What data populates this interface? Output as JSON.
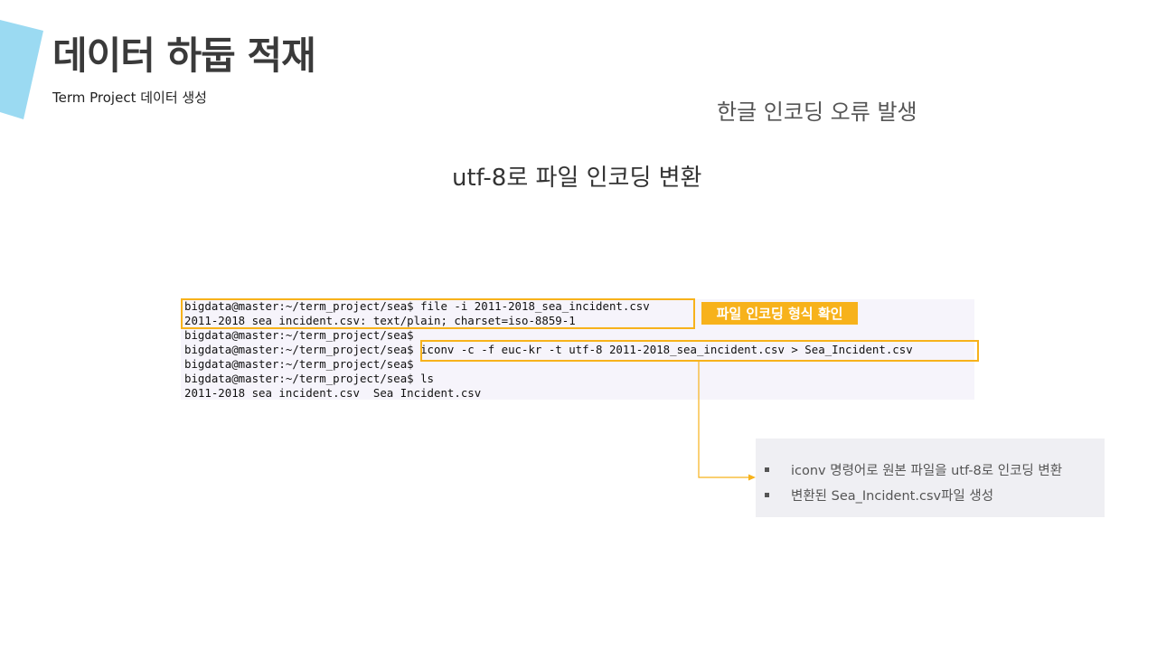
{
  "slide": {
    "title": "데이터 하둡 적재",
    "subtitle": "Term Project 데이터 생성",
    "note_top": "한글 인코딩 오류 발생",
    "heading": "utf-8로 파일 인코딩 변환"
  },
  "terminal": {
    "lines": [
      "bigdata@master:~/term_project/sea$ file -i 2011-2018_sea_incident.csv",
      "2011-2018 sea incident.csv: text/plain; charset=iso-8859-1",
      "bigdata@master:~/term_project/sea$",
      "bigdata@master:~/term_project/sea$ iconv -c -f euc-kr -t utf-8 2011-2018_sea_incident.csv > Sea_Incident.csv",
      "bigdata@master:~/term_project/sea$",
      "bigdata@master:~/term_project/sea$ ls",
      "2011-2018 sea incident.csv  Sea Incident.csv"
    ]
  },
  "callout": {
    "label": "파일 인코딩 형식 확인"
  },
  "info": {
    "items": [
      "iconv 명령어로 원본 파일을 utf-8로 인코딩 변환",
      "변환된 Sea_Incident.csv파일 생성"
    ]
  },
  "colors": {
    "accent": "#f7b21b",
    "shape": "#9bdaf2",
    "terminal_bg": "#f6f4fb",
    "info_bg": "#efeff3"
  }
}
